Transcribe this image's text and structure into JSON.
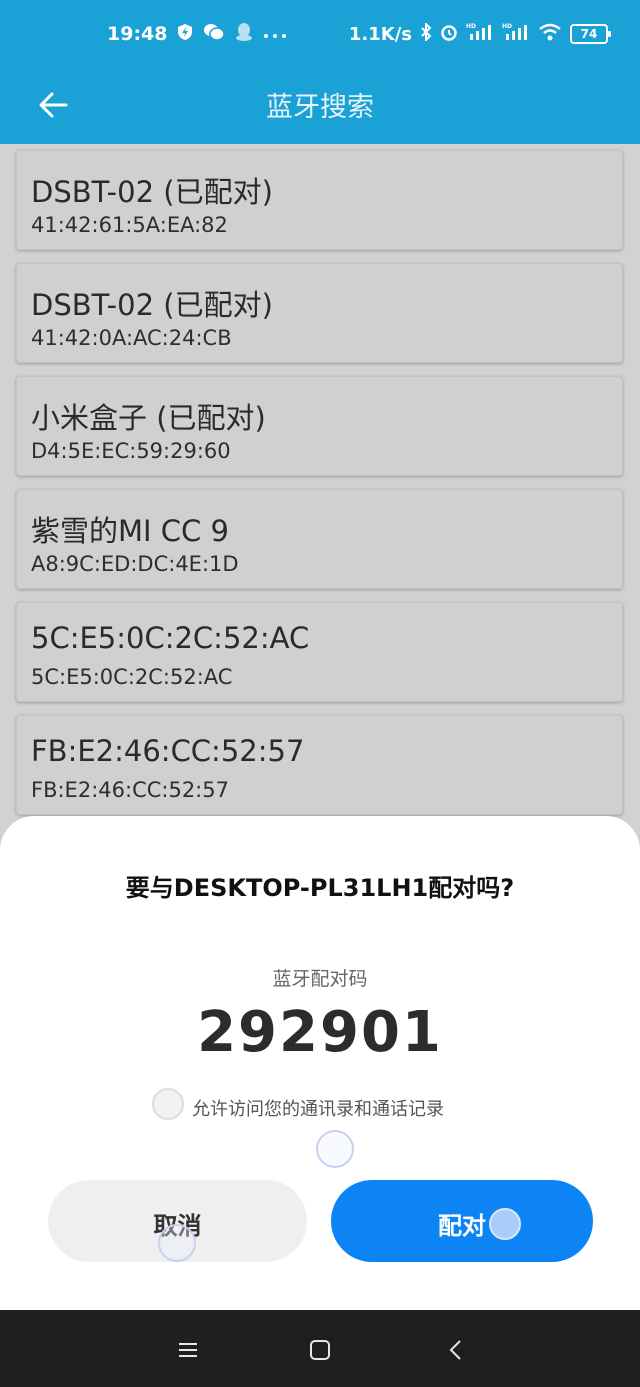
{
  "status_bar": {
    "time": "19:48",
    "net_speed": "1.1K/s",
    "battery": "74",
    "left_icons": [
      "shield-icon",
      "wechat-icon",
      "qq-icon",
      "more-icon"
    ],
    "right_icons": [
      "bluetooth-icon",
      "alarm-icon",
      "signal-hd-icon",
      "signal-hd-icon",
      "wifi-icon",
      "battery-icon"
    ]
  },
  "app_bar": {
    "title": "蓝牙搜索",
    "back_icon": "back-arrow-icon"
  },
  "devices": [
    {
      "name": "DSBT-02 (已配对)",
      "address": "41:42:61:5A:EA:82"
    },
    {
      "name": "DSBT-02 (已配对)",
      "address": "41:42:0A:AC:24:CB"
    },
    {
      "name": "小米盒子 (已配对)",
      "address": "D4:5E:EC:59:29:60"
    },
    {
      "name": "紫雪的MI CC 9",
      "address": "A8:9C:ED:DC:4E:1D"
    },
    {
      "name": "5C:E5:0C:2C:52:AC",
      "address": "5C:E5:0C:2C:52:AC"
    },
    {
      "name": "FB:E2:46:CC:52:57",
      "address": "FB:E2:46:CC:52:57"
    }
  ],
  "dialog": {
    "title": "要与DESKTOP-PL31LH1配对吗?",
    "pin_label": "蓝牙配对码",
    "pin_code": "292901",
    "contacts_option": "允许访问您的通讯录和通话记录",
    "contacts_checked": false,
    "cancel_label": "取消",
    "pair_label": "配对",
    "pair_color": "#0d84f3"
  },
  "nav_bar": {
    "icons": [
      "menu-icon",
      "home-icon",
      "back-icon"
    ]
  },
  "colors": {
    "accent": "#1aa2d6",
    "dialog_bg": "#ffffff",
    "nav_bg": "#1d1f21"
  }
}
